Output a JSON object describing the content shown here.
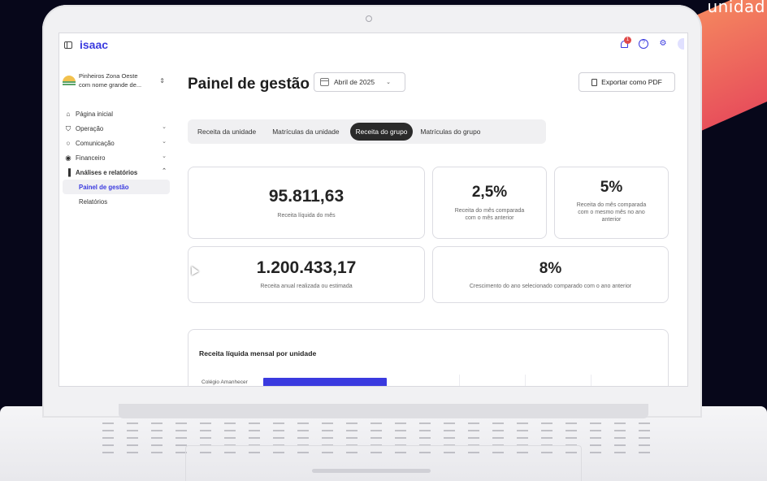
{
  "decor": {
    "corner_text": "unidad"
  },
  "app": {
    "logo": "isaac",
    "notification_count": "1"
  },
  "sidebar": {
    "school_line1": "Pinheiros Zona Oeste",
    "school_line2": "com nome grande de...",
    "items": [
      {
        "label": "Página inicial",
        "icon": "home-icon",
        "chevron": ""
      },
      {
        "label": "Operação",
        "icon": "graduation-cap-icon",
        "chevron": "⌄"
      },
      {
        "label": "Comunicação",
        "icon": "chat-icon",
        "chevron": "⌄"
      },
      {
        "label": "Financeiro",
        "icon": "dollar-circle-icon",
        "chevron": "⌄"
      },
      {
        "label": "Análises e relatórios",
        "icon": "bar-chart-icon",
        "chevron": "⌃"
      }
    ],
    "sub_items": [
      {
        "label": "Painel de gestão",
        "active": true
      },
      {
        "label": "Relatórios",
        "active": false
      }
    ]
  },
  "header": {
    "title": "Painel de gestão",
    "date_value": "Abril de 2025",
    "export_label": "Exportar como PDF"
  },
  "tabs": [
    {
      "label": "Receita da unidade",
      "active": false
    },
    {
      "label": "Matrículas da unidade",
      "active": false
    },
    {
      "label": "Receita do grupo",
      "active": true
    },
    {
      "label": "Matrículas do grupo",
      "active": false
    }
  ],
  "kpis": {
    "monthly_net": {
      "value": "95.811,63",
      "label": "Receita líquida do mês"
    },
    "mom": {
      "value": "2,5%",
      "label_line1": "Receita do mês comparada",
      "label_line2": "com o mês anterior"
    },
    "yoy_month": {
      "value": "5%",
      "label_line1": "Receita do mês comparada",
      "label_line2": "com o mesmo mês no ano",
      "label_line3": "anterior"
    },
    "annual": {
      "value": "1.200.433,17",
      "label": "Receita anual realizada ou estimada"
    },
    "yoy_growth": {
      "value": "8%",
      "label": "Crescimento do ano selecionado comparado com o ano anterior"
    }
  },
  "chart": {
    "title": "Receita líquida mensal por unidade",
    "accent": "#3a3adf"
  },
  "chart_data": {
    "type": "bar",
    "title": "Receita líquida mensal por unidade",
    "categories": [
      "Colégio Amanhecer"
    ],
    "visible_bar_fraction_of_axis": [
      0.38
    ]
  },
  "colors": {
    "brand": "#3a3adf",
    "active_tab": "#2a2a2a",
    "decor_orange": "#f4845f",
    "decor_blue": "#8fc3f7"
  }
}
